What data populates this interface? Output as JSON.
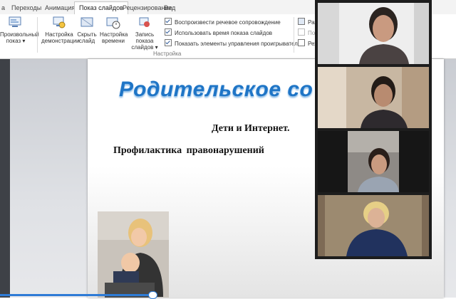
{
  "ribbon": {
    "tabs": [
      {
        "label": "а"
      },
      {
        "label": "Переходы"
      },
      {
        "label": "Анимация"
      },
      {
        "label": "Показ слайдов",
        "active": true
      },
      {
        "label": "Рецензирование"
      },
      {
        "label": "Вид"
      }
    ],
    "buttons": {
      "custom_show": "Произвольный показ",
      "setup_show": "Настройка демонстрации",
      "hide_slide": "Скрыть слайд",
      "rehearse": "Настройка времени",
      "record": "Запись показа слайдов"
    },
    "options": [
      {
        "label": "Воспроизвести речевое сопровождение",
        "checked": true
      },
      {
        "label": "Использовать время показа слайдов",
        "checked": true
      },
      {
        "label": "Показать элементы управления проигрывателем",
        "checked": true
      }
    ],
    "group_label": "Настройка",
    "right_items": [
      {
        "label": "Разр"
      },
      {
        "label": "Пок"
      },
      {
        "label": "Реж"
      }
    ]
  },
  "slide": {
    "title": "Родительское со",
    "subtitle1": "Дети и Интернет.",
    "subtitle2": "Профилактика правонарушений"
  },
  "video": {
    "participants": [
      {
        "name": "participant-1"
      },
      {
        "name": "participant-2"
      },
      {
        "name": "participant-3"
      },
      {
        "name": "participant-4"
      }
    ]
  },
  "playback": {
    "progress_fraction": 0.34
  },
  "colors": {
    "title_blue": "#1f75c6",
    "accent": "#2b5797"
  }
}
